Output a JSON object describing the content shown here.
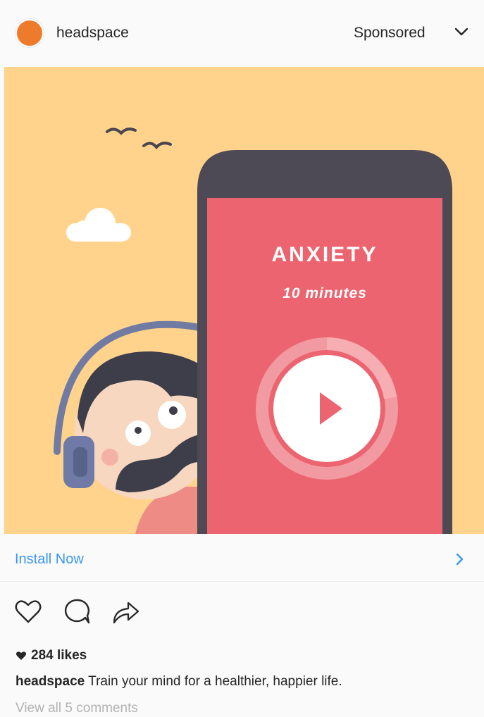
{
  "post": {
    "account": "headspace",
    "sponsored_label": "Sponsored",
    "icons": {
      "avatar": "headspace-logo-dot",
      "menu": "chevron-down-icon",
      "like": "heart-outline-icon",
      "comment": "speech-bubble-icon",
      "share": "share-arrow-icon",
      "likes_heart": "filled-heart-icon",
      "cta_arrow": "chevron-right-icon"
    },
    "colors": {
      "brand_orange": "#ee7b2c",
      "ad_background": "#ffd38c",
      "cta_blue": "#3897f0",
      "phone_screen": "#ec646f"
    }
  },
  "ad": {
    "title": "ANXIETY",
    "subtitle": "10 minutes"
  },
  "cta": {
    "label": "Install Now"
  },
  "engagement": {
    "likes": "284 likes",
    "caption_user": "headspace",
    "caption_text": " Train your mind for a healthier, happier life.",
    "comments_link": "View all 5 comments"
  }
}
